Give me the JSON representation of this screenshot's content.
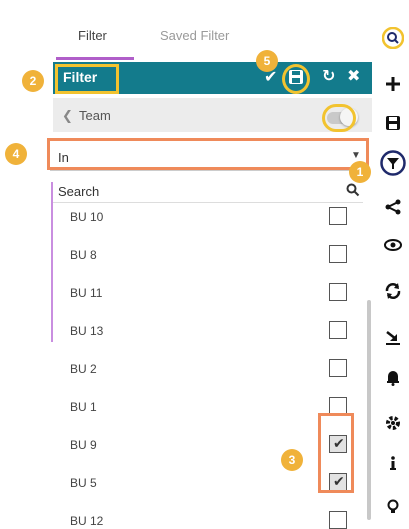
{
  "tabs": [
    {
      "label": "Filter",
      "active": true
    },
    {
      "label": "Saved Filter",
      "active": false
    }
  ],
  "panel": {
    "title": "Filter",
    "team_label": "Team",
    "toggle_on": true,
    "operator_value": "In",
    "search_label": "Search"
  },
  "list": {
    "items": [
      {
        "label": "BU 10",
        "checked": false
      },
      {
        "label": "BU 8",
        "checked": false
      },
      {
        "label": "BU 11",
        "checked": false
      },
      {
        "label": "BU 13",
        "checked": false
      },
      {
        "label": "BU 2",
        "checked": false
      },
      {
        "label": "BU 1",
        "checked": false
      },
      {
        "label": "BU 9",
        "checked": true
      },
      {
        "label": "BU 5",
        "checked": true
      },
      {
        "label": "BU 12",
        "checked": false
      }
    ]
  },
  "callouts": {
    "c1": "1",
    "c2": "2",
    "c3": "3",
    "c4": "4",
    "c5": "5"
  },
  "toolbar_icons": [
    "search-icon",
    "plus-icon",
    "save-icon",
    "filter-icon",
    "share-icon",
    "eye-icon",
    "refresh-icon",
    "export-icon",
    "bell-icon",
    "gear-icon",
    "info-icon",
    "bulb-icon"
  ],
  "colors": {
    "header": "#137b8c",
    "callout": "#f0b23a",
    "highlight_yellow": "#f2c32f",
    "highlight_orange": "#ef8a5a",
    "filter_ring": "#1f2a6b",
    "tab_accent": "#b05ec9"
  }
}
